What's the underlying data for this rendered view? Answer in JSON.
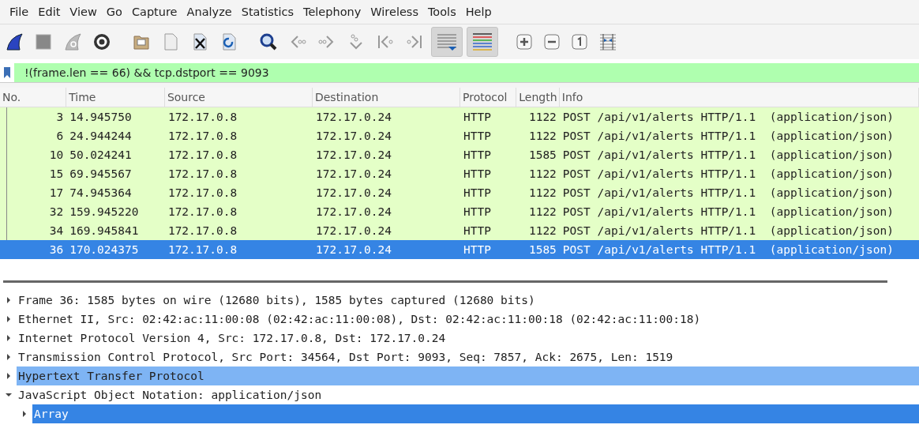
{
  "menu": [
    "File",
    "Edit",
    "View",
    "Go",
    "Capture",
    "Analyze",
    "Statistics",
    "Telephony",
    "Wireless",
    "Tools",
    "Help"
  ],
  "toolbar": {
    "autoscroll_on": true,
    "colorize_on": true
  },
  "display_filter": {
    "value": "!(frame.len == 66) && tcp.dstport == 9093"
  },
  "packet_list": {
    "columns": [
      "No.",
      "Time",
      "Source",
      "Destination",
      "Protocol",
      "Length",
      "Info"
    ],
    "rows": [
      {
        "cells": [
          "3",
          "14.945750",
          "172.17.0.8",
          "172.17.0.24",
          "HTTP",
          "1122",
          "POST /api/v1/alerts HTTP/1.1  (application/json)"
        ],
        "selected": false
      },
      {
        "cells": [
          "6",
          "24.944244",
          "172.17.0.8",
          "172.17.0.24",
          "HTTP",
          "1122",
          "POST /api/v1/alerts HTTP/1.1  (application/json)"
        ],
        "selected": false
      },
      {
        "cells": [
          "10",
          "50.024241",
          "172.17.0.8",
          "172.17.0.24",
          "HTTP",
          "1585",
          "POST /api/v1/alerts HTTP/1.1  (application/json)"
        ],
        "selected": false
      },
      {
        "cells": [
          "15",
          "69.945567",
          "172.17.0.8",
          "172.17.0.24",
          "HTTP",
          "1122",
          "POST /api/v1/alerts HTTP/1.1  (application/json)"
        ],
        "selected": false
      },
      {
        "cells": [
          "17",
          "74.945364",
          "172.17.0.8",
          "172.17.0.24",
          "HTTP",
          "1122",
          "POST /api/v1/alerts HTTP/1.1  (application/json)"
        ],
        "selected": false
      },
      {
        "cells": [
          "32",
          "159.945220",
          "172.17.0.8",
          "172.17.0.24",
          "HTTP",
          "1122",
          "POST /api/v1/alerts HTTP/1.1  (application/json)"
        ],
        "selected": false
      },
      {
        "cells": [
          "34",
          "169.945841",
          "172.17.0.8",
          "172.17.0.24",
          "HTTP",
          "1122",
          "POST /api/v1/alerts HTTP/1.1  (application/json)"
        ],
        "selected": false
      },
      {
        "cells": [
          "36",
          "170.024375",
          "172.17.0.8",
          "172.17.0.24",
          "HTTP",
          "1585",
          "POST /api/v1/alerts HTTP/1.1  (application/json)"
        ],
        "selected": true
      }
    ]
  },
  "packet_details": [
    {
      "label": "Frame 36: 1585 bytes on wire (12680 bits), 1585 bytes captured (12680 bits)",
      "expanded": false,
      "related": false,
      "selected": false
    },
    {
      "label": "Ethernet II, Src: 02:42:ac:11:00:08 (02:42:ac:11:00:08), Dst: 02:42:ac:11:00:18 (02:42:ac:11:00:18)",
      "expanded": false,
      "related": false,
      "selected": false
    },
    {
      "label": "Internet Protocol Version 4, Src: 172.17.0.8, Dst: 172.17.0.24",
      "expanded": false,
      "related": false,
      "selected": false
    },
    {
      "label": "Transmission Control Protocol, Src Port: 34564, Dst Port: 9093, Seq: 7857, Ack: 2675, Len: 1519",
      "expanded": false,
      "related": false,
      "selected": false
    },
    {
      "label": "Hypertext Transfer Protocol",
      "expanded": false,
      "related": true,
      "selected": false
    },
    {
      "label": "JavaScript Object Notation: application/json",
      "expanded": true,
      "related": false,
      "selected": false,
      "children": [
        {
          "label": "Array",
          "expanded": false,
          "related": false,
          "selected": true
        }
      ]
    }
  ]
}
